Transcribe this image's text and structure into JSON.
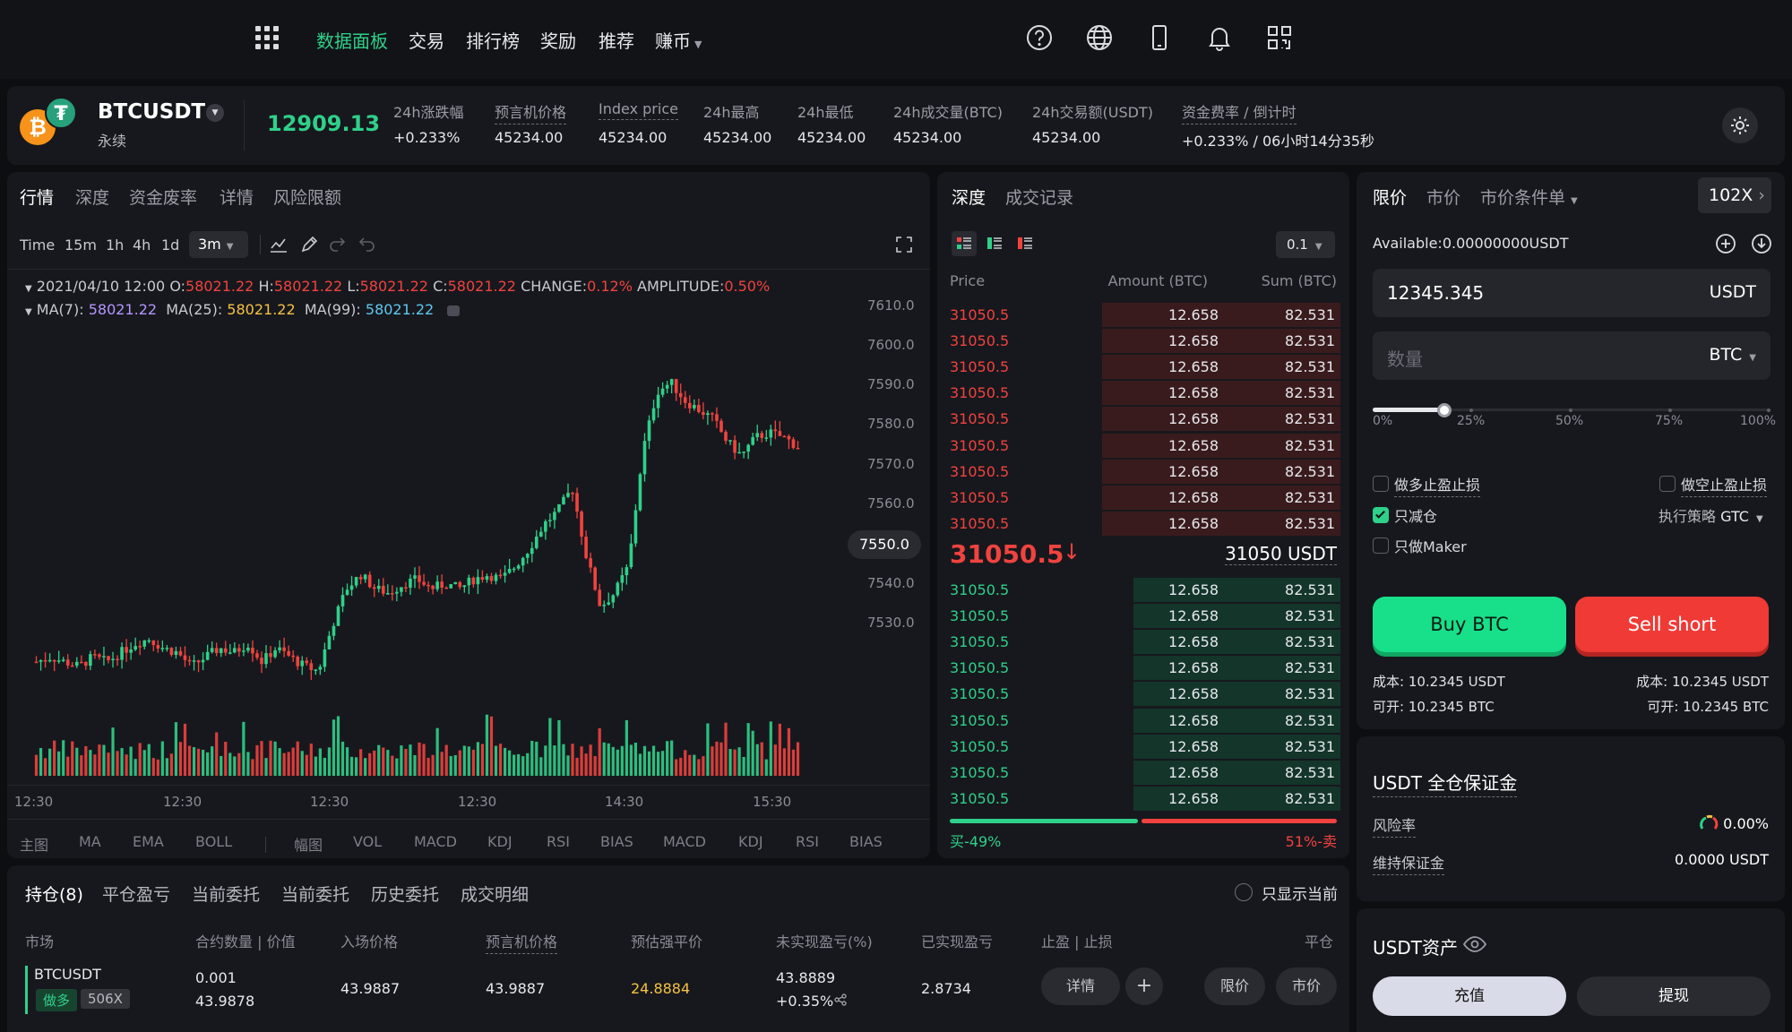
{
  "nav": {
    "items": [
      "数据面板",
      "交易",
      "排行榜",
      "奖励",
      "推荐",
      "赚币"
    ],
    "active": "数据面板"
  },
  "ticker": {
    "symbol": "BTCUSDT",
    "type": "永续",
    "price": "12909.13",
    "stats": [
      {
        "label": "24h涨跌幅",
        "value": "+0.233%",
        "color": "green"
      },
      {
        "label": "预言机价格",
        "value": "45234.00"
      },
      {
        "label": "Index price",
        "value": "45234.00"
      },
      {
        "label": "24h最高",
        "value": "45234.00"
      },
      {
        "label": "24h最低",
        "value": "45234.00"
      },
      {
        "label": "24h成交量(BTC)",
        "value": "45234.00"
      },
      {
        "label": "24h交易额(USDT)",
        "value": "45234.00"
      },
      {
        "label": "资金费率 / 倒计时",
        "value": "+0.233% / 06小时14分35秒",
        "color": "green"
      }
    ]
  },
  "chart": {
    "tabs": [
      "行情",
      "深度",
      "资金废率",
      "详情",
      "风险限额"
    ],
    "timeframes": [
      "Time",
      "15m",
      "1h",
      "4h",
      "1d"
    ],
    "selected_tf": "3m",
    "ohlc": {
      "date": "2021/04/10 12:00",
      "o_label": "O:",
      "o": "58021.22",
      "h_label": "H:",
      "h": "58021.22",
      "l_label": "L:",
      "l": "58021.22",
      "c_label": "C:",
      "c": "58021.22",
      "change_label": "CHANGE:",
      "change": "0.12%",
      "amp_label": "AMPLITUDE:",
      "amp": "0.50%"
    },
    "ma": {
      "ma7_label": "MA(7):",
      "ma7": "58021.22",
      "ma25_label": "MA(25):",
      "ma25": "58021.22",
      "ma99_label": "MA(99):",
      "ma99": "58021.22"
    },
    "current_price_tag": "7550.0",
    "indicators": [
      "主图",
      "MA",
      "EMA",
      "BOLL",
      "幅图",
      "VOL",
      "MACD",
      "KDJ",
      "RSI",
      "BIAS",
      "MACD",
      "KDJ",
      "RSI",
      "BIAS"
    ]
  },
  "chart_data": {
    "type": "candlestick",
    "y_ticks": [
      "7610.0",
      "7600.0",
      "7590.0",
      "7580.0",
      "7570.0",
      "7560.0",
      "7550.0",
      "7540.0",
      "7530.0",
      "7530.0",
      "7530.0"
    ],
    "x_ticks": [
      "12:30",
      "12:30",
      "12:30",
      "12:30",
      "14:30",
      "15:30"
    ],
    "ylim": [
      7525,
      7615
    ],
    "close_path": [
      7537,
      7538,
      7537,
      7536,
      7538,
      7537,
      7539,
      7541,
      7542,
      7540,
      7539,
      7536,
      7538,
      7540,
      7539,
      7541,
      7537,
      7540,
      7538,
      7536,
      7535,
      7545,
      7553,
      7556,
      7553,
      7552,
      7554,
      7555,
      7553,
      7554,
      7553,
      7555,
      7556,
      7555,
      7558,
      7562,
      7567,
      7570,
      7575,
      7560,
      7549,
      7552,
      7558,
      7583,
      7596,
      7598,
      7594,
      7592,
      7590,
      7585,
      7582,
      7586,
      7587,
      7586,
      7584
    ]
  },
  "orderbook": {
    "tabs": [
      "深度",
      "成交记录"
    ],
    "precision": "0.1",
    "headers": [
      "Price",
      "Amount (BTC)",
      "Sum (BTC)"
    ],
    "asks": [
      {
        "price": "31050.5",
        "amount": "12.658",
        "sum": "82.531",
        "fill": 0.98
      },
      {
        "price": "31050.5",
        "amount": "12.658",
        "sum": "82.531",
        "fill": 0.98
      },
      {
        "price": "31050.5",
        "amount": "12.658",
        "sum": "82.531",
        "fill": 0.98
      },
      {
        "price": "31050.5",
        "amount": "12.658",
        "sum": "82.531",
        "fill": 0.98
      },
      {
        "price": "31050.5",
        "amount": "12.658",
        "sum": "82.531",
        "fill": 0.98
      },
      {
        "price": "31050.5",
        "amount": "12.658",
        "sum": "82.531",
        "fill": 0.98
      },
      {
        "price": "31050.5",
        "amount": "12.658",
        "sum": "82.531",
        "fill": 0.98
      },
      {
        "price": "31050.5",
        "amount": "12.658",
        "sum": "82.531",
        "fill": 0.98
      },
      {
        "price": "31050.5",
        "amount": "12.658",
        "sum": "82.531",
        "fill": 0.98
      }
    ],
    "mid_price": "31050.5",
    "mid_usdt": "31050 USDT",
    "bids": [
      {
        "price": "31050.5",
        "amount": "12.658",
        "sum": "82.531",
        "fill": 0.85
      },
      {
        "price": "31050.5",
        "amount": "12.658",
        "sum": "82.531",
        "fill": 0.85
      },
      {
        "price": "31050.5",
        "amount": "12.658",
        "sum": "82.531",
        "fill": 0.85
      },
      {
        "price": "31050.5",
        "amount": "12.658",
        "sum": "82.531",
        "fill": 0.85
      },
      {
        "price": "31050.5",
        "amount": "12.658",
        "sum": "82.531",
        "fill": 0.85
      },
      {
        "price": "31050.5",
        "amount": "12.658",
        "sum": "82.531",
        "fill": 0.85
      },
      {
        "price": "31050.5",
        "amount": "12.658",
        "sum": "82.531",
        "fill": 0.85
      },
      {
        "price": "31050.5",
        "amount": "12.658",
        "sum": "82.531",
        "fill": 0.85
      },
      {
        "price": "31050.5",
        "amount": "12.658",
        "sum": "82.531",
        "fill": 0.85
      }
    ],
    "buy_ratio_label": "买-49%",
    "sell_ratio_label": "51%-卖",
    "buy_ratio": 0.49
  },
  "trade": {
    "tabs": [
      "限价",
      "市价",
      "市价条件单"
    ],
    "leverage": "102X",
    "available_label": "Available:",
    "available": "0.00000000USDT",
    "price_value": "12345.345",
    "price_unit": "USDT",
    "qty_placeholder": "数量",
    "qty_unit": "BTC",
    "slider_ticks": [
      "0%",
      "25%",
      "50%",
      "75%",
      "100%"
    ],
    "slider_value": 0.18,
    "opt_long_tpsl": "做多止盈止损",
    "opt_short_tpsl": "做空止盈止损",
    "opt_reduce": "只减仓",
    "opt_maker": "只做Maker",
    "strategy_label": "执行策略",
    "strategy": "GTC",
    "buy_label": "Buy BTC",
    "sell_label": "Sell short",
    "buy_cost": "成本: 10.2345 USDT",
    "buy_open": "可开: 10.2345 BTC",
    "sell_cost": "成本: 10.2345 USDT",
    "sell_open": "可开: 10.2345 BTC"
  },
  "margin": {
    "title": "USDT 全仓保证金",
    "risk_label": "风险率",
    "risk": "0.00%",
    "maint_label": "维持保证金",
    "maint": "0.0000 USDT"
  },
  "assets": {
    "title": "USDT资产",
    "deposit": "充值",
    "withdraw": "提现"
  },
  "positions": {
    "tabs": [
      "持仓(8)",
      "平仓盈亏",
      "当前委托",
      "当前委托",
      "历史委托",
      "成交明细"
    ],
    "only_current": "只显示当前",
    "headers": [
      "市场",
      "合约数量 | 价值",
      "入场价格",
      "预言机价格",
      "预估强平价",
      "未实现盈亏(%)",
      "已实现盈亏",
      "止盈 | 止损",
      "平仓"
    ],
    "row": {
      "market": "BTCUSDT",
      "side": "做多",
      "lev": "506X",
      "qty": "0.001",
      "value": "43.9878",
      "entry": "43.9887",
      "oracle": "43.9887",
      "liq": "24.8884",
      "upnl": "43.8889",
      "upnl_pct": "+0.35%",
      "rpnl": "2.8734",
      "detail": "详情",
      "plus": "+",
      "limit": "限价",
      "market_close": "市价"
    }
  }
}
